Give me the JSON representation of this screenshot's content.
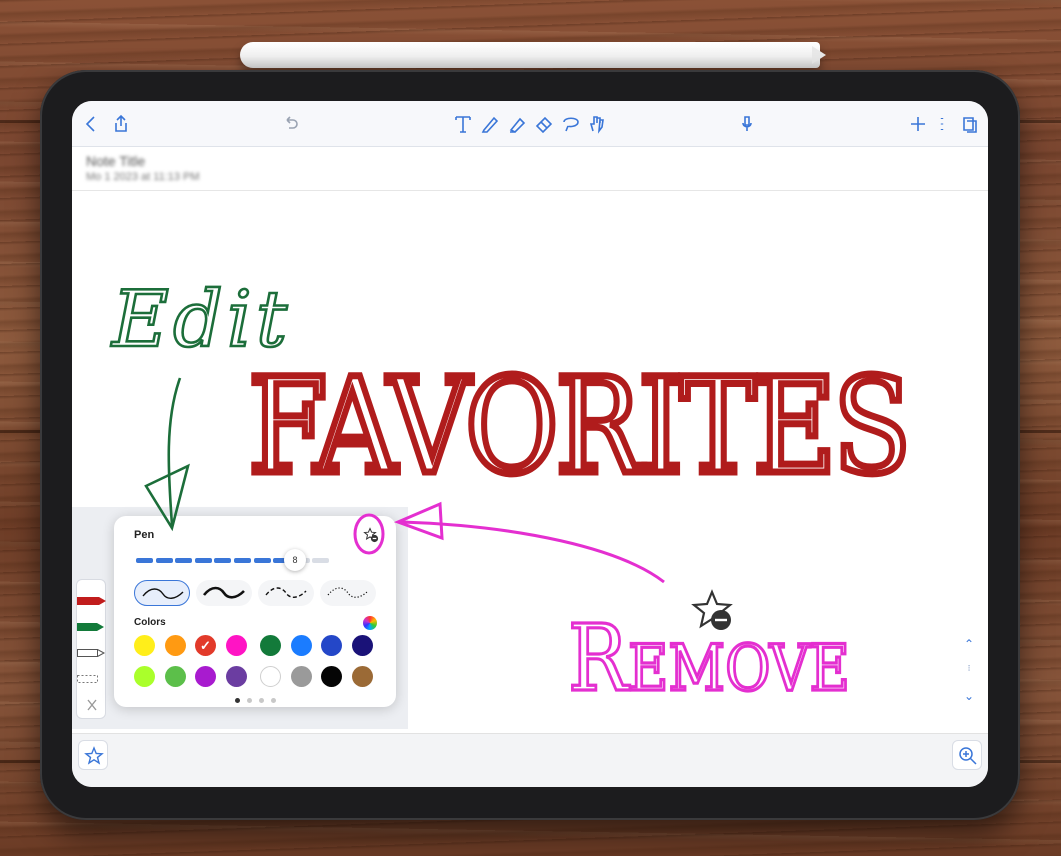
{
  "note": {
    "title": "Note Title",
    "date": "Mo 1 2023 at 11:13 PM"
  },
  "toolbar": {
    "icons": [
      "back-icon",
      "share-icon",
      "undo-icon",
      "text-tool-icon",
      "pen-tool-icon",
      "highlighter-tool-icon",
      "eraser-tool-icon",
      "lasso-tool-icon",
      "hand-tool-icon",
      "microphone-icon",
      "add-icon",
      "more-icon",
      "pages-icon"
    ]
  },
  "pen_popover": {
    "label": "Pen",
    "size_value": "8",
    "size_fraction": 0.8,
    "colors_label": "Colors",
    "stroke_styles": [
      "smooth-fine",
      "smooth-bold",
      "dashed",
      "dotted"
    ],
    "selected_stroke": 0,
    "colors": [
      {
        "hex": "#ffee1a"
      },
      {
        "hex": "#ff9a12"
      },
      {
        "hex": "#e23a2a",
        "selected": true
      },
      {
        "hex": "#ff14c4"
      },
      {
        "hex": "#137a3a"
      },
      {
        "hex": "#1b7cff"
      },
      {
        "hex": "#2447c8"
      },
      {
        "hex": "#1a1278"
      },
      {
        "hex": "#aaff2b"
      },
      {
        "hex": "#5cbf4a"
      },
      {
        "hex": "#a81bcf"
      },
      {
        "hex": "#6b3da1"
      },
      {
        "hex": "#ffffff"
      },
      {
        "hex": "#9a9a9a"
      },
      {
        "hex": "#050505"
      },
      {
        "hex": "#9b6a36"
      }
    ],
    "page_dots": 4,
    "active_dot": 0
  },
  "annotations": {
    "edit_text": "Edit",
    "favorites_text": "FAVORITES",
    "remove_text": "Remove",
    "edit_color": "#1c6e3a",
    "favorites_color": "#b01c1c",
    "remove_color": "#e42fd0"
  }
}
